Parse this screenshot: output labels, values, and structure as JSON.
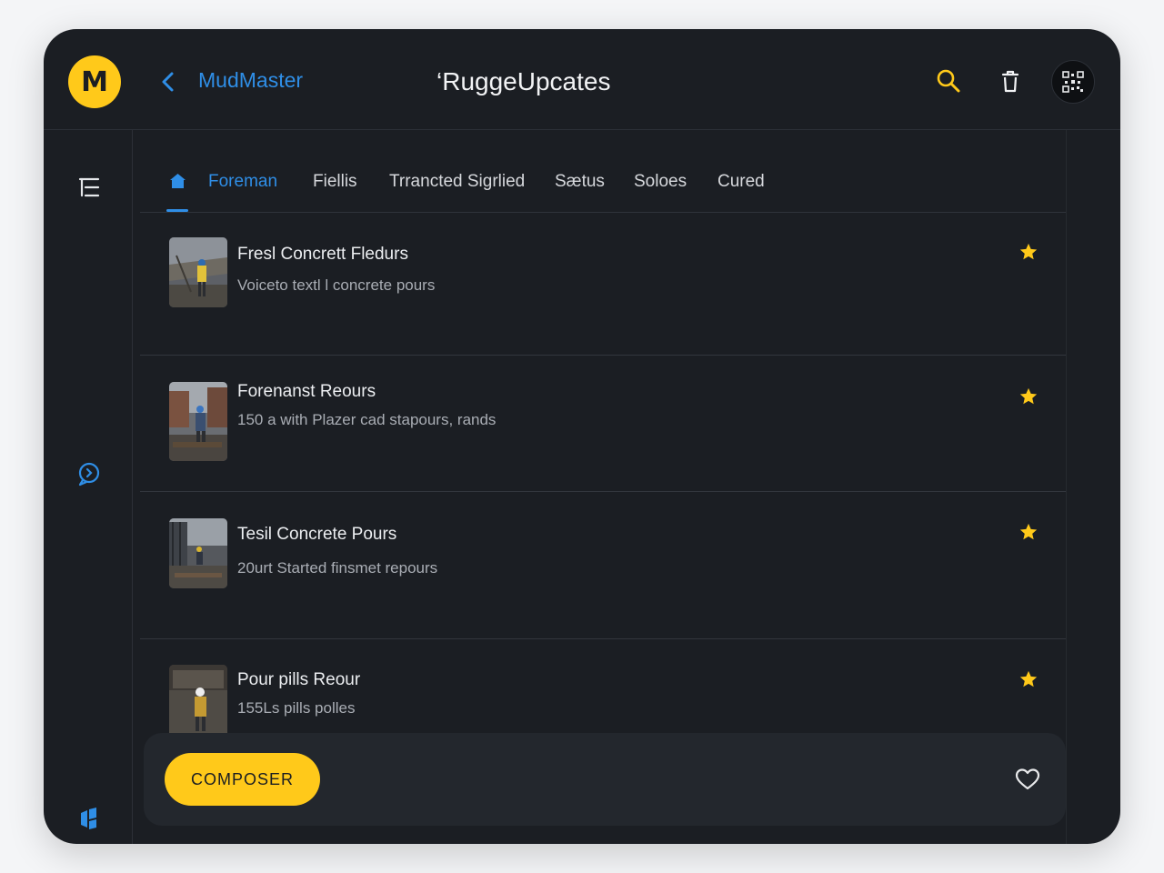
{
  "app": {
    "logo_letter": "M",
    "name": "MudMaster",
    "title": "‘RuggeUpcates"
  },
  "header": {
    "icons": [
      "search-icon",
      "trash-icon"
    ],
    "avatar_icon": "qr-badge-icon"
  },
  "rail": {
    "icons": [
      "list-tree-icon",
      "chat-search-icon",
      "blocks-icon"
    ]
  },
  "tabs": [
    {
      "label": "Foreman",
      "active": true,
      "icon": "home-icon"
    },
    {
      "label": "Fiellis",
      "active": false
    },
    {
      "label": "Trrancted Sigrlied",
      "active": false
    },
    {
      "label": "Sætus",
      "active": false
    },
    {
      "label": "Soloes",
      "active": false
    },
    {
      "label": "Cured",
      "active": false
    }
  ],
  "items": [
    {
      "title": "Fresl Concrett Fledurs",
      "subtitle": "Voiceto textl l concrete pours",
      "starred": true
    },
    {
      "title": "Forenanst Reours",
      "subtitle": "150 a with Plazer cad stapours, rands",
      "starred": true
    },
    {
      "title": "Tesil Concrete Pours",
      "subtitle": "20urt Started finsmet repours",
      "starred": true
    },
    {
      "title": "Pour pills Reour",
      "subtitle": "155Ls pills polles",
      "starred": true
    }
  ],
  "bottom_bar": {
    "compose_label": "COMPOSER",
    "favorite_icon": "heart-icon"
  },
  "colors": {
    "accent_yellow": "#ffc91a",
    "accent_blue": "#2f8ee6",
    "background": "#1b1e23"
  }
}
